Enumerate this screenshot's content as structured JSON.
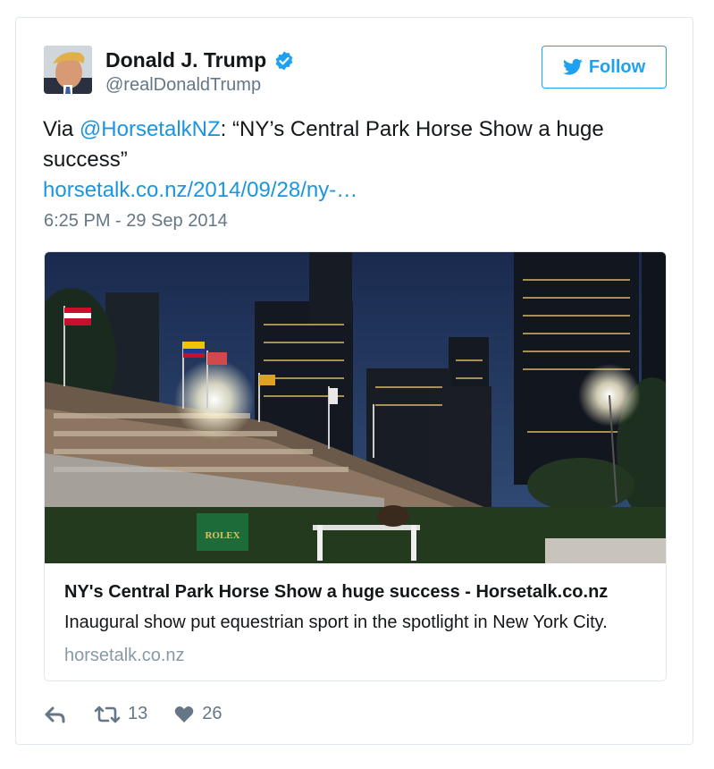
{
  "author": {
    "name": "Donald J. Trump",
    "handle": "@realDonaldTrump"
  },
  "follow_label": "Follow",
  "tweet": {
    "prefix": "Via ",
    "mention": "@HorsetalkNZ",
    "body": ": “NY’s Central Park Horse Show a huge success”",
    "url": "horsetalk.co.nz/2014/09/28/ny-…",
    "timestamp": "6:25 PM - 29 Sep 2014"
  },
  "card": {
    "title": "NY's Central Park Horse Show a huge success - Horsetalk.co.nz",
    "description": "Inaugural show put equestrian sport in the spotlight in New York City.",
    "domain": "horsetalk.co.nz",
    "banner_text": "ROLEX"
  },
  "actions": {
    "retweets": "13",
    "likes": "26"
  },
  "colors": {
    "accent": "#1da1f2",
    "link": "#1b95e0",
    "muted": "#657786"
  },
  "icons": [
    "verified-badge-icon",
    "twitter-bird-icon",
    "reply-icon",
    "retweet-icon",
    "heart-icon"
  ]
}
